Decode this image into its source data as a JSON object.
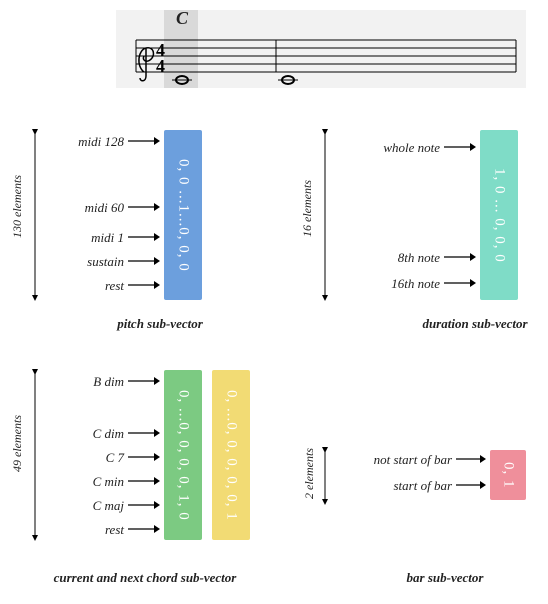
{
  "music": {
    "chord": "C"
  },
  "pitch": {
    "axis": "130 elements",
    "labels": [
      "midi 128",
      "midi 60",
      "midi 1",
      "sustain",
      "rest"
    ],
    "vector_text": "0, 0 ...1...0, 0, 0",
    "caption": "pitch sub-vector"
  },
  "duration": {
    "axis": "16 elements",
    "labels": [
      "whole note",
      "8th note",
      "16th note"
    ],
    "vector_text": "1, 0 ... 0, 0, 0",
    "caption": "duration sub-vector"
  },
  "chord": {
    "axis": "49 elements",
    "labels": [
      "B dim",
      "C dim",
      "C 7",
      "C min",
      "C maj",
      "rest"
    ],
    "vector_current": "0, ...0, 0, 0, 0, 1, 0",
    "vector_next": "0, ...0, 0, 0, 0, 0, 1",
    "caption": "current and next chord sub-vector"
  },
  "bar": {
    "axis": "2 elements",
    "labels": [
      "not start of bar",
      "start of bar"
    ],
    "vector_text": "0, 1",
    "caption": "bar sub-vector"
  }
}
